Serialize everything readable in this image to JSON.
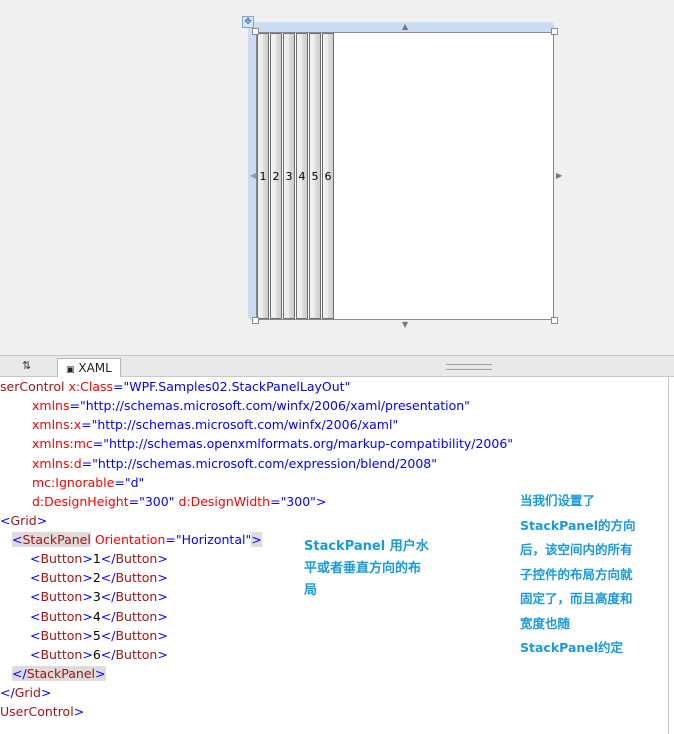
{
  "designer": {
    "move_glyph": "✥",
    "buttons": [
      "1",
      "2",
      "3",
      "4",
      "5",
      "6"
    ]
  },
  "tabs": {
    "swap_label": "⇅",
    "xaml_label": "XAML",
    "xaml_icon": "▣"
  },
  "code": {
    "l1": {
      "open": "",
      "tag": "serControl",
      "attr": "x:Class",
      "eq": "=",
      "val": "\"WPF.Samples02.StackPanelLayOut\""
    },
    "l2": {
      "attr": "xmlns",
      "eq": "=",
      "val": "\"http://schemas.microsoft.com/winfx/2006/xaml/presentation\""
    },
    "l3": {
      "attr": "xmlns:x",
      "eq": "=",
      "val": "\"http://schemas.microsoft.com/winfx/2006/xaml\""
    },
    "l4": {
      "attr": "xmlns:mc",
      "eq": "=",
      "val": "\"http://schemas.openxmlformats.org/markup-compatibility/2006\""
    },
    "l5": {
      "attr": "xmlns:d",
      "eq": "=",
      "val": "\"http://schemas.microsoft.com/expression/blend/2008\""
    },
    "l6": {
      "attr": "mc:Ignorable",
      "eq": "=",
      "val": "\"d\""
    },
    "l7": {
      "attr1": "d:DesignHeight",
      "eq": "=",
      "val1": "\"300\"",
      "attr2": "d:DesignWidth",
      "val2": "\"300\"",
      "close": ">"
    },
    "l8": {
      "open": "<",
      "tag": "Grid",
      "close": ">"
    },
    "l9": {
      "open": "<",
      "tag": "StackPanel",
      "attr": "Orientation",
      "eq": "=",
      "val": "\"Horizontal\"",
      "close": ">"
    },
    "buttons": [
      {
        "o": "<",
        "t": "Button",
        "c": ">",
        "text": "1",
        "o2": "</",
        "c2": ">"
      },
      {
        "o": "<",
        "t": "Button",
        "c": ">",
        "text": "2",
        "o2": "</",
        "c2": ">"
      },
      {
        "o": "<",
        "t": "Button",
        "c": ">",
        "text": "3",
        "o2": "</",
        "c2": ">"
      },
      {
        "o": "<",
        "t": "Button",
        "c": ">",
        "text": "4",
        "o2": "</",
        "c2": ">"
      },
      {
        "o": "<",
        "t": "Button",
        "c": ">",
        "text": "5",
        "o2": "</",
        "c2": ">"
      },
      {
        "o": "<",
        "t": "Button",
        "c": ">",
        "text": "6",
        "o2": "</",
        "c2": ">"
      }
    ],
    "l16": {
      "open": "</",
      "tag": "StackPanel",
      "close": ">"
    },
    "l17": {
      "open": "</",
      "tag": "Grid",
      "close": ">"
    },
    "l18": {
      "open": "",
      "tag": "UserControl",
      "close": ">"
    }
  },
  "notes": {
    "middle": [
      "StackPanel 用户水",
      "平或者垂直方向的布",
      "局"
    ],
    "right": [
      "当我们设置了",
      "StackPanel的方向",
      "后，该空间内的所有",
      "子控件的布局方向就",
      "固定了，而且高度和",
      "宽度也随",
      "StackPanel约定"
    ]
  }
}
